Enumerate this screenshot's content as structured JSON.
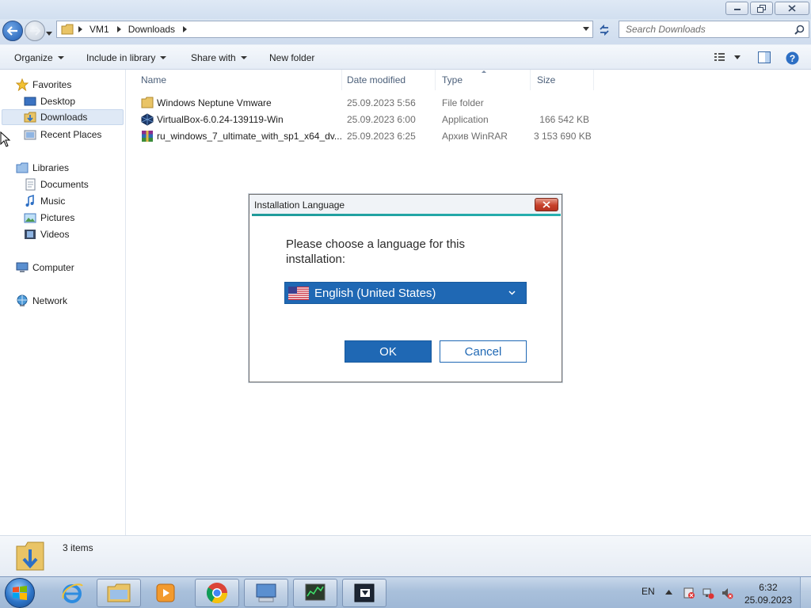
{
  "window": {
    "caption": {
      "minimize_icon": "minimize-icon",
      "restore_icon": "restore-icon",
      "close_icon": "close-icon"
    },
    "address": {
      "crumbs": [
        "VM1",
        "Downloads"
      ],
      "search_placeholder": "Search Downloads"
    },
    "toolbar": {
      "organize": "Organize",
      "include_in_library": "Include in library",
      "share_with": "Share with",
      "new_folder": "New folder"
    },
    "nav": {
      "favorites": "Favorites",
      "desktop": "Desktop",
      "downloads": "Downloads",
      "recent_places": "Recent Places",
      "libraries": "Libraries",
      "documents": "Documents",
      "music": "Music",
      "pictures": "Pictures",
      "videos": "Videos",
      "computer": "Computer",
      "network": "Network"
    },
    "columns": {
      "name": "Name",
      "date_modified": "Date modified",
      "type": "Type",
      "size": "Size"
    },
    "files": [
      {
        "name": "Windows Neptune Vmware",
        "date": "25.09.2023 5:56",
        "type": "File folder",
        "size": "",
        "icon": "folder-icon"
      },
      {
        "name": "VirtualBox-6.0.24-139119-Win",
        "date": "25.09.2023 6:00",
        "type": "Application",
        "size": "166 542 KB",
        "icon": "virtualbox-icon"
      },
      {
        "name": "ru_windows_7_ultimate_with_sp1_x64_dv...",
        "date": "25.09.2023 6:25",
        "type": "Архив WinRAR",
        "size": "3 153 690 KB",
        "icon": "winrar-icon"
      }
    ],
    "details": {
      "items_count": "3 items"
    }
  },
  "dialog": {
    "title": "Installation Language",
    "prompt": "Please choose a language for this installation:",
    "selected_language": "English (United States)",
    "ok": "OK",
    "cancel": "Cancel"
  },
  "taskbar": {
    "language": "EN",
    "time": "6:32",
    "date": "25.09.2023"
  }
}
